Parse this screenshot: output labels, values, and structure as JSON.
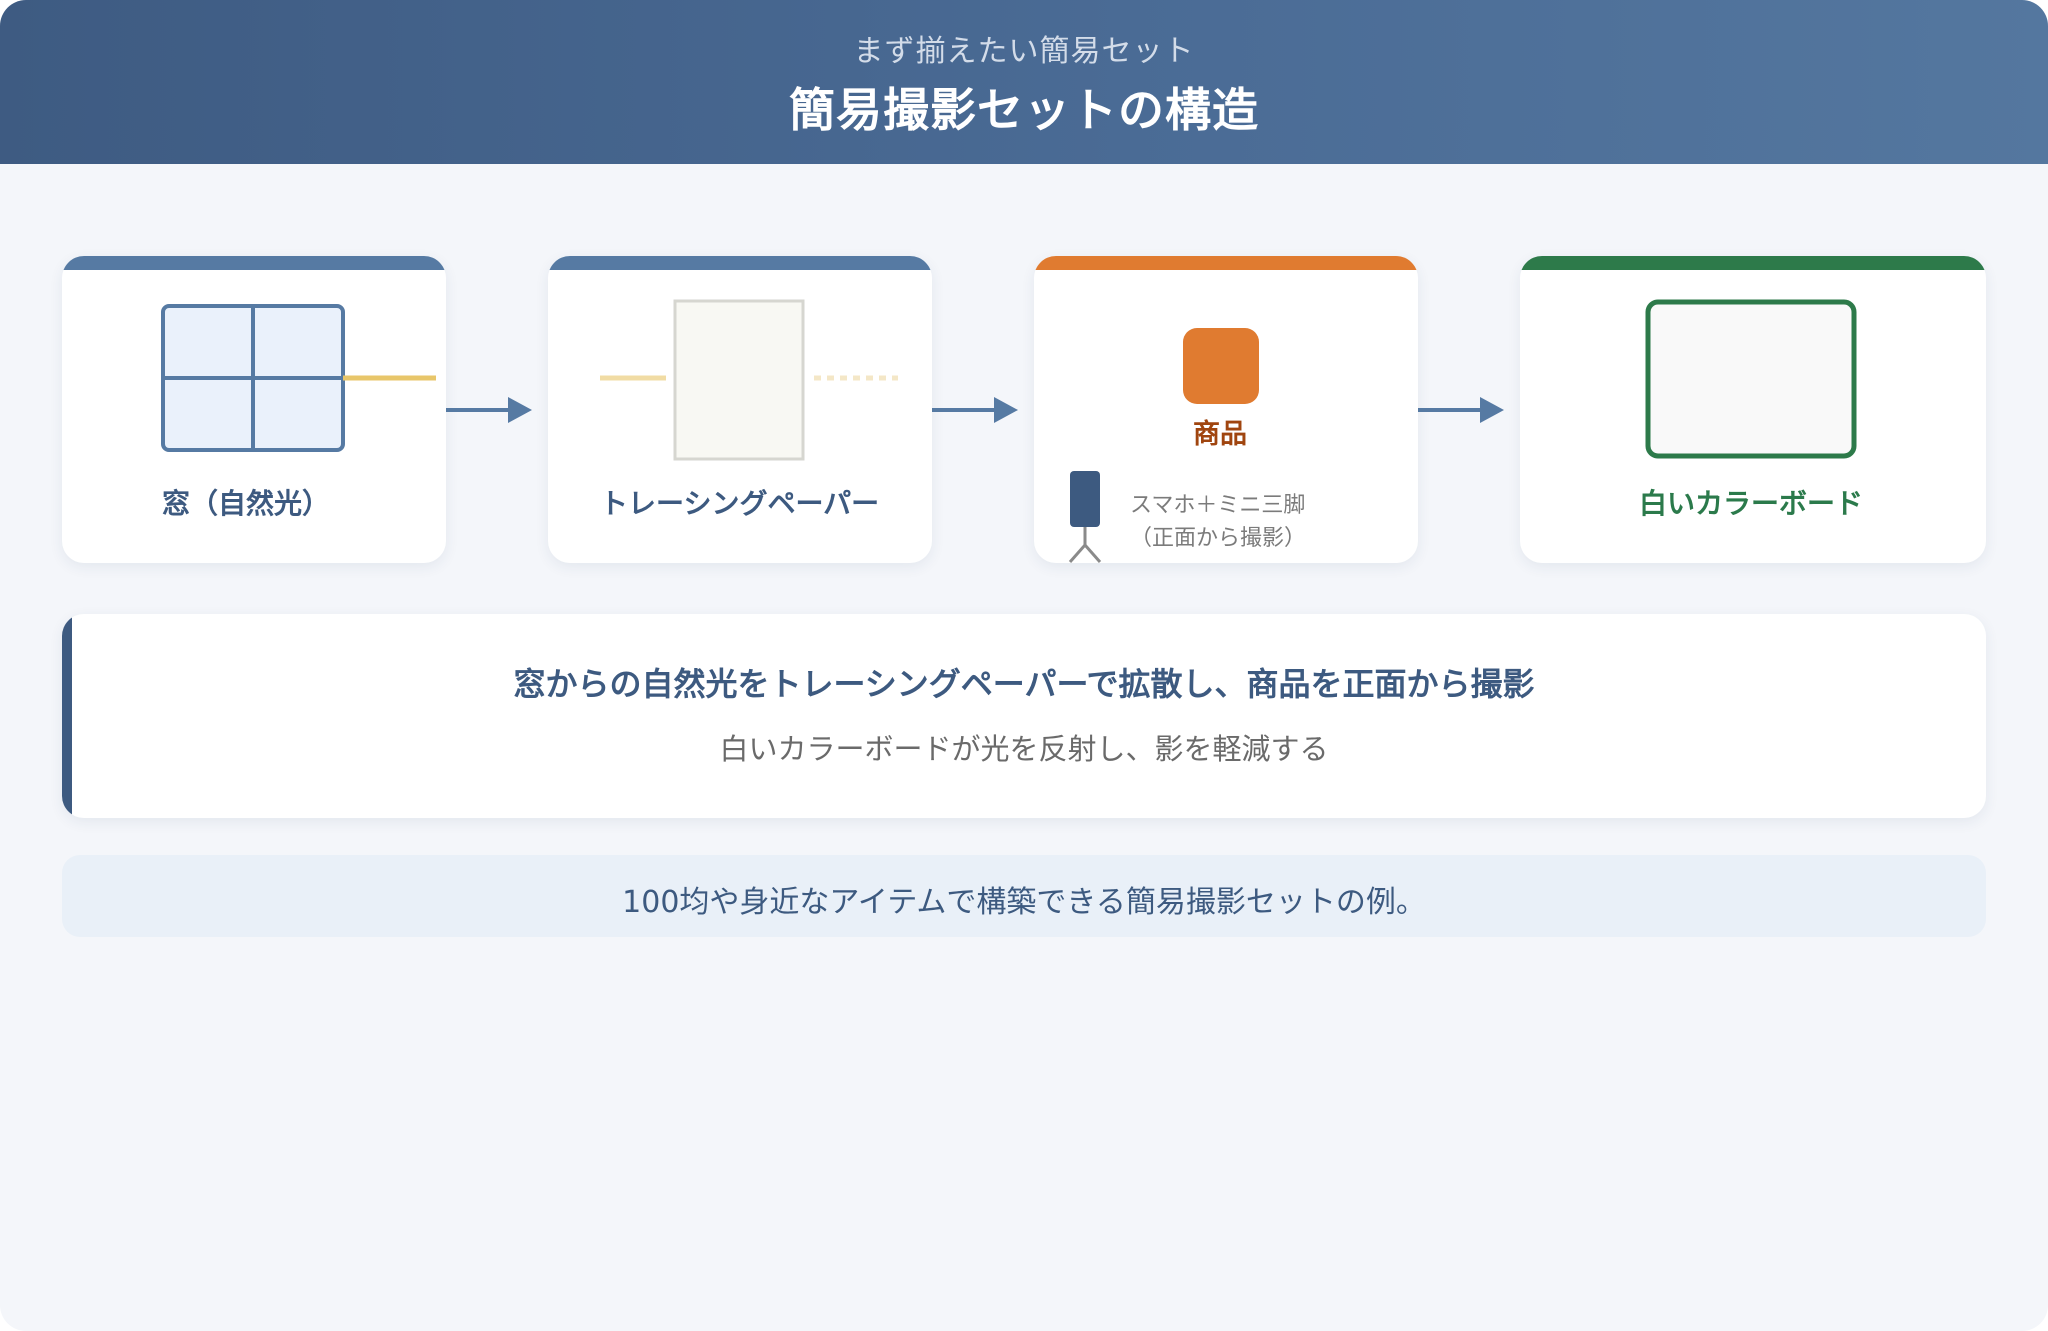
{
  "header": {
    "subtitle": "まず揃えたい簡易セット",
    "title": "簡易撮影セットの構造"
  },
  "cards": {
    "window": {
      "label": "窓（自然光）",
      "color": "#3d5a80"
    },
    "paper": {
      "label": "トレーシングペーパー",
      "color": "#3d5a80"
    },
    "product": {
      "label": "商品",
      "phone_label_1": "スマホ＋ミニ三脚",
      "phone_label_2": "（正面から撮影）",
      "color": "#a0450f"
    },
    "board": {
      "label": "白いカラーボード",
      "color": "#2b7a4b"
    }
  },
  "summary": {
    "main": "窓からの自然光をトレーシングペーパーで拡散し、商品を正面から撮影",
    "sub": "白いカラーボードが光を反射し、影を軽減する"
  },
  "note": {
    "text": "100均や身近なアイテムで構築できる簡易撮影セットの例。"
  },
  "colors": {
    "blue_accent": "#567aa3",
    "orange_accent": "#e07b30",
    "green_accent": "#2d7a4a",
    "light_beam": "#e8c66a"
  }
}
